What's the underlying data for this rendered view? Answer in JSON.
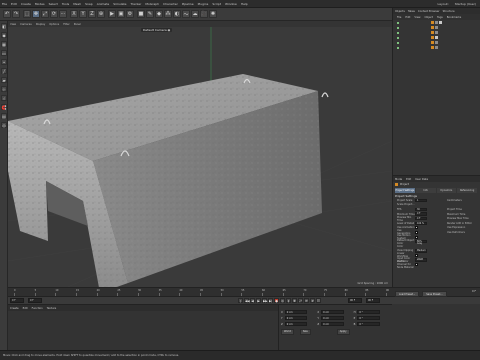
{
  "menubar": {
    "items": [
      "File",
      "Edit",
      "Create",
      "Modes",
      "Select",
      "Tools",
      "Mesh",
      "Snap",
      "Animate",
      "Simulate",
      "Tracker",
      "MoGraph",
      "Character",
      "Pipeline",
      "Plugins",
      "Script",
      "Window",
      "Help"
    ],
    "layout_label": "Layout:",
    "layout_value": "Startup (User)"
  },
  "toolbar": {
    "icons": [
      "undo-icon",
      "redo-icon",
      "live-selection-icon",
      "move-icon",
      "scale-icon",
      "rotate-icon",
      "recent-tools-icon",
      "x-axis-icon",
      "y-axis-icon",
      "z-axis-icon",
      "coordinate-system-icon",
      "render-view-icon",
      "render-picture-viewer-icon",
      "edit-render-settings-icon",
      "cube-icon",
      "pen-icon",
      "subdivision-icon",
      "array-icon",
      "boole-icon",
      "deformer-icon",
      "environment-icon",
      "camera-icon",
      "light-icon"
    ],
    "glyphs": [
      "↶",
      "↷",
      "⬚",
      "✥",
      "⤢",
      "⟳",
      "⋯",
      "X",
      "Y",
      "Z",
      "⊕",
      "▶",
      "▣",
      "⚙",
      "■",
      "✎",
      "◆",
      "⁂",
      "◐",
      "〜",
      "☁",
      "🎥",
      "✺"
    ]
  },
  "lefttools": {
    "icons": [
      "make-editable-icon",
      "model-mode-icon",
      "texture-mode-icon",
      "workplane-icon",
      "points-mode-icon",
      "edges-mode-icon",
      "polygons-mode-icon",
      "enable-axis-icon",
      "tweak-icon",
      "snap-icon",
      "workplane-lock-icon",
      "solo-icon"
    ],
    "glyphs": [
      "◧",
      "◆",
      "▦",
      "▭",
      "•",
      "╱",
      "▰",
      "⊹",
      "☝",
      "🧲",
      "▤",
      "◎"
    ]
  },
  "viewport": {
    "menu": [
      "View",
      "Cameras",
      "Display",
      "Options",
      "Filter",
      "Panel"
    ],
    "camera_label": "Default Camera",
    "camera_label_icon": "camera-icon",
    "grid_spacing": "Grid Spacing : 1000 cm"
  },
  "objects_panel": {
    "header": [
      "Objects",
      "Takes",
      "Content Browser",
      "Structure"
    ],
    "tabs": [
      "File",
      "Edit",
      "View",
      "Object",
      "Tags",
      "Bookmarks"
    ],
    "rows": [
      {
        "name": "",
        "tag_colors": [
          "#d48a24",
          "#8b8b8b",
          "#c9c9c9"
        ]
      },
      {
        "name": "",
        "tag_colors": [
          "#d48a24",
          "#8b8b8b"
        ]
      },
      {
        "name": "",
        "tag_colors": [
          "#d48a24",
          "#8b8b8b"
        ]
      },
      {
        "name": "",
        "tag_colors": [
          "#d48a24",
          "#c9c9c9"
        ]
      },
      {
        "name": "",
        "tag_colors": [
          "#d48a24",
          "#8b8b8b"
        ]
      },
      {
        "name": "",
        "tag_colors": [
          "#d48a24",
          "#8b8b8b"
        ]
      }
    ]
  },
  "attributes_panel": {
    "header": [
      "Mode",
      "Edit",
      "User Data"
    ],
    "doc_label": "Project",
    "tabs": [
      "Project Settings",
      "Info",
      "Dynamics",
      "Referencing"
    ],
    "active_tab": 0,
    "section_title": "Project Settings",
    "rows": [
      {
        "label": "Project Scale",
        "value": "1",
        "right": "Centimeters"
      },
      {
        "label": "Scale Project...",
        "value": "",
        "right": ""
      },
      {
        "label": "FPS",
        "value": "30",
        "right": "Project Time"
      },
      {
        "label": "Minimum Time",
        "value": "0 F",
        "right": "Maximum Time"
      },
      {
        "label": "Preview Min Time",
        "value": "0 F",
        "right": "Preview Max Time"
      },
      {
        "label": "Level of Detail",
        "value": "100 %",
        "right": "Render LOD in Editor"
      },
      {
        "label": "Use Animation",
        "value": "check",
        "right": "Use Expression"
      },
      {
        "label": "Use Generators",
        "value": "check",
        "right": "Use Deformers"
      },
      {
        "label": "Use Motion System",
        "value": "check",
        "right": ""
      },
      {
        "label": "Default Object Color",
        "value": "80% Gray",
        "right": ""
      },
      {
        "label": "Color",
        "value": "",
        "right": ""
      },
      {
        "label": "View Clipping",
        "value": "Medium",
        "right": ""
      },
      {
        "label": "Linear Workflow",
        "value": "check",
        "right": ""
      },
      {
        "label": "Input Color Profile",
        "value": "sRGB",
        "right": ""
      },
      {
        "label": "Use Color Channel for Node Material",
        "value": "check",
        "right": ""
      }
    ],
    "buttons": [
      "Load Preset...",
      "Save Preset..."
    ]
  },
  "timeline": {
    "ticks": [
      "0",
      "5",
      "10",
      "15",
      "20",
      "25",
      "30",
      "35",
      "40",
      "45",
      "50",
      "55",
      "60",
      "65",
      "70",
      "75",
      "80",
      "85",
      "90"
    ],
    "current_frame": "0 F"
  },
  "playback": {
    "start": "0 F",
    "current": "0 F",
    "end": "90 F",
    "end2": "90 F",
    "controls": [
      "|◀",
      "◀◀",
      "◀",
      "▶",
      "▶▶",
      "▶|",
      "●",
      "◎",
      "⚷",
      "✥",
      "⤢",
      "⟳",
      "P",
      "☷"
    ]
  },
  "materials": {
    "menu": [
      "Create",
      "Edit",
      "Function",
      "Texture"
    ]
  },
  "coords": {
    "rows": [
      {
        "a": "X",
        "av": "0 cm",
        "b": "X",
        "bv": "0 cm",
        "c": "H",
        "cv": "0 °"
      },
      {
        "a": "Y",
        "av": "0 cm",
        "b": "Y",
        "bv": "0 cm",
        "c": "P",
        "cv": "0 °"
      },
      {
        "a": "Z",
        "av": "0 cm",
        "b": "Z",
        "bv": "0 cm",
        "c": "B",
        "cv": "0 °"
      }
    ],
    "mode1": "World",
    "mode2": "Size",
    "apply": "Apply"
  },
  "statusbar": {
    "text": "Move: Click and drag to move elements. Hold down SHIFT to quantize movement / add to the selection in point mode, CTRL to remove."
  }
}
